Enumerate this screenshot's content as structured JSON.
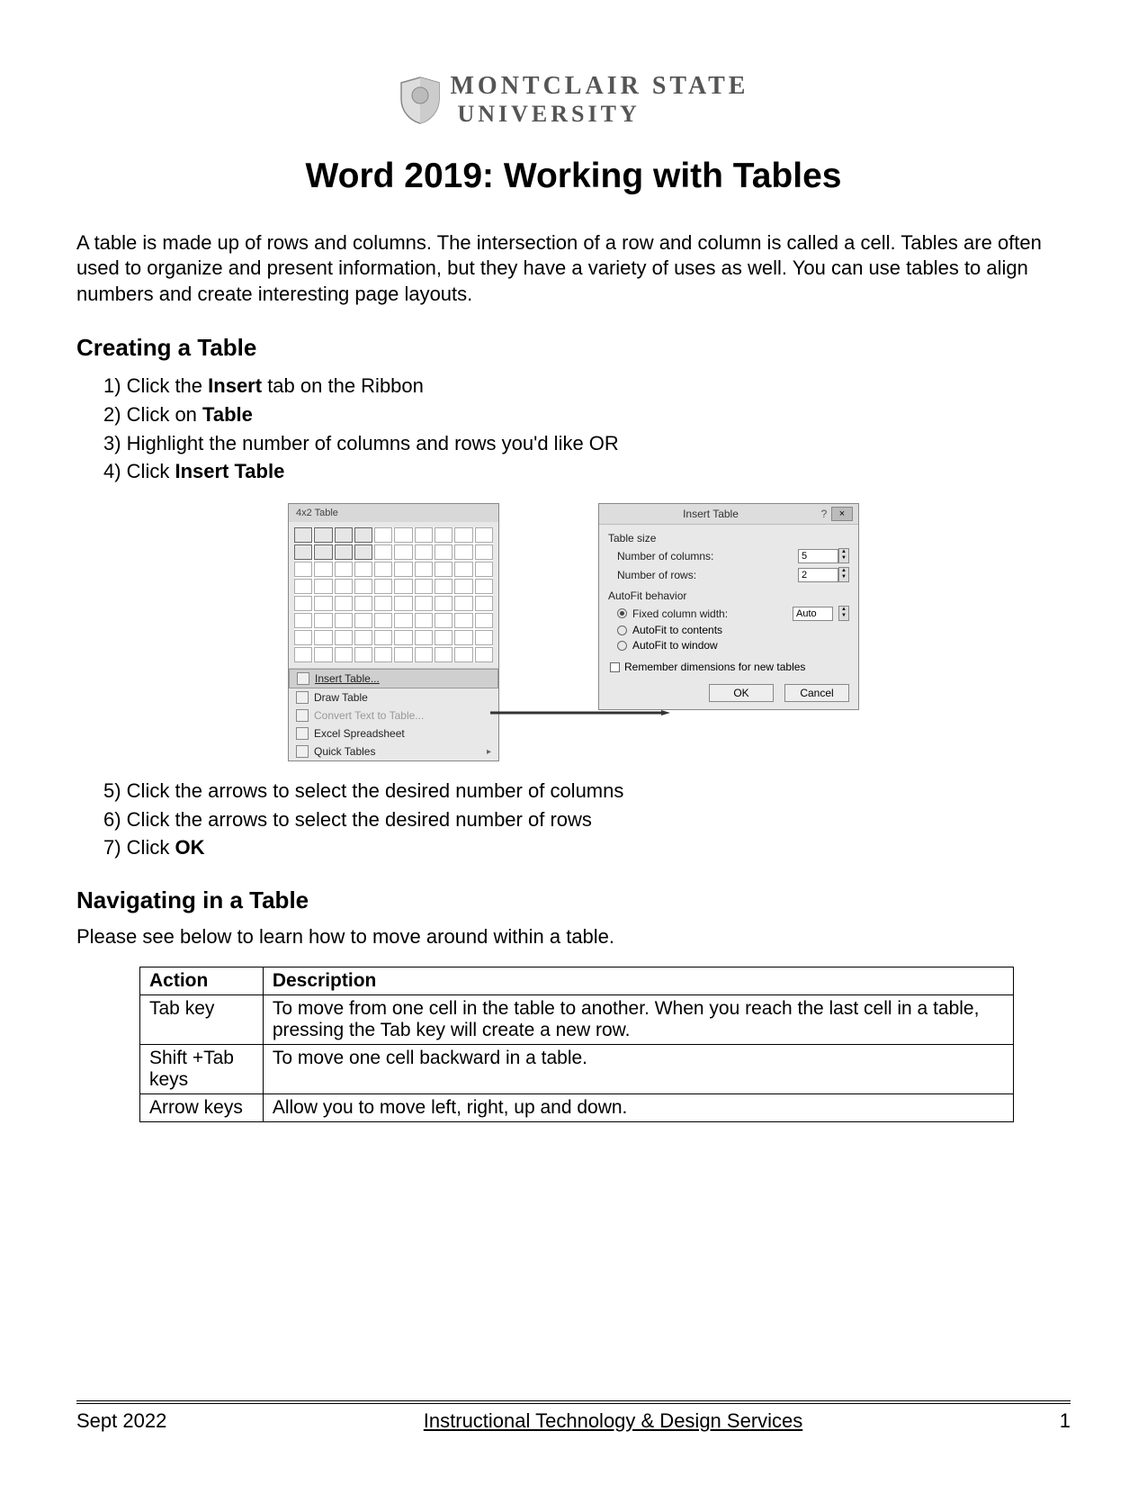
{
  "logo": {
    "line1": "MONTCLAIR STATE",
    "line2": "UNIVERSITY"
  },
  "title": "Word 2019: Working with Tables",
  "intro": "A table is made up of rows and columns. The intersection of a row and column is called a cell. Tables are often used to organize and present information, but they have a variety of uses as well. You can use tables to align numbers and create interesting page layouts.",
  "section1": "Creating a Table",
  "steps1": [
    {
      "prefix": "1) Click the ",
      "bold": "Insert",
      "suffix": " tab on the Ribbon"
    },
    {
      "prefix": "2) Click on ",
      "bold": "Table",
      "suffix": ""
    },
    {
      "prefix": "3) Highlight the number of columns and rows you'd like OR",
      "bold": "",
      "suffix": ""
    },
    {
      "prefix": "4) Click ",
      "bold": "Insert Table",
      "suffix": ""
    }
  ],
  "table_menu": {
    "header": "4x2 Table",
    "items": [
      {
        "label": "Insert Table...",
        "hl": true
      },
      {
        "label": "Draw Table"
      },
      {
        "label": "Convert Text to Table...",
        "dis": true
      },
      {
        "label": "Excel Spreadsheet"
      },
      {
        "label": "Quick Tables",
        "caret": true
      }
    ]
  },
  "dialog": {
    "title": "Insert Table",
    "help": "?",
    "close": "×",
    "sect_size": "Table size",
    "col_label": "Number of columns:",
    "col_value": "5",
    "row_label": "Number of rows:",
    "row_value": "2",
    "sect_autofit": "AutoFit behavior",
    "fixed_label": "Fixed column width:",
    "fixed_value": "Auto",
    "autofit_contents": "AutoFit to contents",
    "autofit_window": "AutoFit to window",
    "remember": "Remember dimensions for new tables",
    "ok": "OK",
    "cancel": "Cancel"
  },
  "steps2": [
    "5) Click the arrows to select the desired number of columns",
    "6) Click the arrows to select the desired number of rows",
    {
      "prefix": "7) Click ",
      "bold": "OK"
    }
  ],
  "section2": "Navigating in a Table",
  "nav_intro": "Please see below to learn how to move around within a table.",
  "nav_table": {
    "headers": [
      "Action",
      "Description"
    ],
    "rows": [
      [
        "Tab key",
        "To move from one cell in the table to another. When you reach the last cell in a table, pressing the Tab key will create a new row."
      ],
      [
        "Shift +Tab keys",
        "To move one cell backward in a table."
      ],
      [
        "Arrow keys",
        "Allow you to move left, right, up and down."
      ]
    ]
  },
  "footer": {
    "left": "Sept 2022",
    "center": "Instructional Technology & Design Services",
    "right": "1"
  }
}
